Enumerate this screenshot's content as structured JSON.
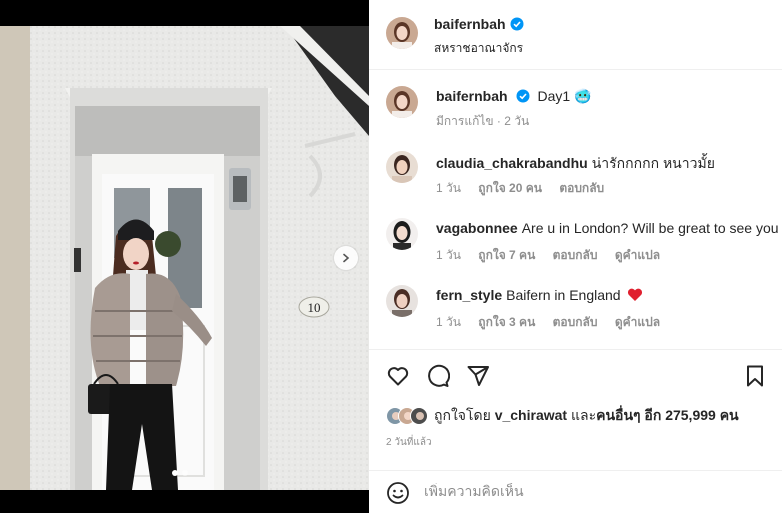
{
  "header": {
    "username": "baifernbah",
    "location": "สหราชอาณาจักร"
  },
  "caption": {
    "username": "baifernbah",
    "text": "Day1",
    "emoji": "🥶",
    "meta_edited": "มีการแก้ไข · 2 วัน"
  },
  "comments": [
    {
      "username": "claudia_chakrabandhu",
      "text": "น่ารักกกกก หนาวมั้ย",
      "time": "1 วัน",
      "likes": "ถูกใจ 20 คน",
      "reply": "ตอบกลับ",
      "translate": ""
    },
    {
      "username": "vagabonnee",
      "text": "Are u in London? Will be great to see you",
      "time": "1 วัน",
      "likes": "ถูกใจ 7 คน",
      "reply": "ตอบกลับ",
      "translate": "ดูคำแปล"
    },
    {
      "username": "fern_style",
      "text": "Baifern in England",
      "emoji": "❤️",
      "time": "1 วัน",
      "likes": "ถูกใจ 3 คน",
      "reply": "ตอบกลับ",
      "translate": "ดูคำแปล"
    }
  ],
  "likes": {
    "prefix": "ถูกใจโดย",
    "user": "v_chirawat",
    "middle": "และ",
    "others": "คนอื่นๆ อีก 275,999 คน"
  },
  "post_time": "2 วันที่แล้ว",
  "add_comment": {
    "placeholder": "เพิ่มความคิดเห็น"
  },
  "photo": {
    "door_number": "10"
  },
  "colors": {
    "verified": "#0095f6",
    "heart": "#ed4956",
    "muted": "#8e8e8e"
  },
  "icons": [
    "heart-icon",
    "comment-icon",
    "share-icon",
    "bookmark-icon",
    "emoji-icon",
    "chevron-right-icon",
    "verified-icon"
  ]
}
